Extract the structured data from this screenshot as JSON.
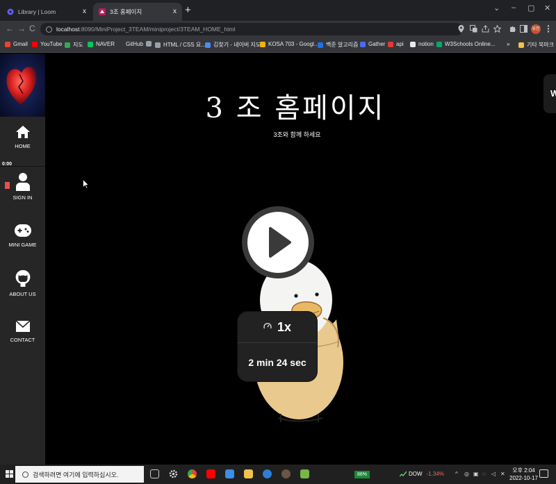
{
  "browser": {
    "tabs": [
      {
        "title": "Library | Loom",
        "close": "x"
      },
      {
        "title": "3조 홈페이지",
        "close": "x"
      }
    ],
    "new_tab": "+",
    "window_controls": {
      "menu": "⌄",
      "minimize": "–",
      "restore": "▢",
      "close": "✕"
    },
    "nav": {
      "back": "←",
      "forward": "→",
      "reload": "C"
    },
    "address": {
      "host": "localhost",
      "path": ":8090/MiniProject_3TEAM/miniproject/3TEAM_HOME_html"
    },
    "profile_initials": "유진",
    "bookmarks": [
      {
        "label": "Gmail",
        "color": "#ea4335"
      },
      {
        "label": "YouTube",
        "color": "#ff0000"
      },
      {
        "label": "지도",
        "color": "#34a853"
      },
      {
        "label": "NAVER",
        "color": "#03c75a"
      },
      {
        "label": "GitHub",
        "color": "#35363a"
      },
      {
        "label": "",
        "color": "#9aa0a6"
      },
      {
        "label": "HTML / CSS 요...",
        "color": "#9aa0a6"
      },
      {
        "label": "김찾기 - 네이버 지도",
        "color": "#4a8cf0"
      },
      {
        "label": "KOSA 703 - Googl...",
        "color": "#f4b400"
      },
      {
        "label": "백준 알고리즘",
        "color": "#1a73e8"
      },
      {
        "label": "Gather",
        "color": "#4a6cf0"
      },
      {
        "label": "api",
        "color": "#e53935"
      },
      {
        "label": "notion",
        "color": "#e8eaed"
      },
      {
        "label": "W3Schools Online...",
        "color": "#04aa6d"
      }
    ],
    "more_bookmarks": "»",
    "other_bookmarks": "기타 북마크"
  },
  "page": {
    "title": "3 조 홈페이지",
    "subtitle": "3조와 함께 하세요",
    "nav": [
      {
        "label": "HOME",
        "icon": "home-icon"
      },
      {
        "label": "SIGN IN",
        "icon": "user-icon"
      },
      {
        "label": "MINI GAME",
        "icon": "gamepad-icon"
      },
      {
        "label": "ABOUT US",
        "icon": "github-icon"
      },
      {
        "label": "CONTACT",
        "icon": "mail-icon"
      }
    ],
    "edge_letter": "W"
  },
  "loom": {
    "timer": "0:00",
    "speed": "1x",
    "duration": "2 min 24 sec"
  },
  "taskbar": {
    "search_placeholder": "검색하려면 여기에 입력하십시오.",
    "battery": "86%",
    "ticker": "DOW",
    "ticker_change": "-1.34%",
    "time": "오후 2:04",
    "date": "2022-10-17"
  }
}
